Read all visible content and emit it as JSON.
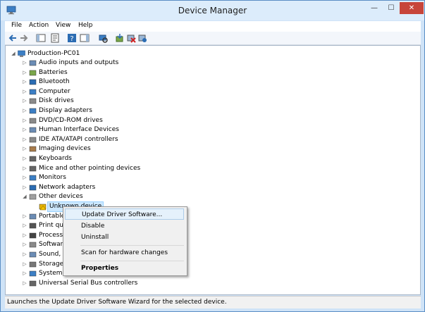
{
  "window": {
    "title": "Device Manager",
    "min_glyph": "—",
    "max_glyph": "☐",
    "close_glyph": "✕"
  },
  "menu": [
    "File",
    "Action",
    "View",
    "Help"
  ],
  "toolbar_icons": [
    "back-icon",
    "forward-icon",
    "show-hide-tree-icon",
    "properties-icon",
    "help-icon",
    "action-pane-icon",
    "scan-hardware-icon",
    "update-driver-icon",
    "disable-device-icon",
    "uninstall-device-icon"
  ],
  "tree": {
    "root": "Production-PC01",
    "items": [
      {
        "label": "Audio inputs and outputs",
        "icon": "speaker-icon",
        "expanded": false
      },
      {
        "label": "Batteries",
        "icon": "battery-icon",
        "expanded": false
      },
      {
        "label": "Bluetooth",
        "icon": "bluetooth-icon",
        "expanded": false
      },
      {
        "label": "Computer",
        "icon": "computer-icon",
        "expanded": false
      },
      {
        "label": "Disk drives",
        "icon": "disk-drive-icon",
        "expanded": false
      },
      {
        "label": "Display adapters",
        "icon": "display-adapter-icon",
        "expanded": false
      },
      {
        "label": "DVD/CD-ROM drives",
        "icon": "dvd-drive-icon",
        "expanded": false
      },
      {
        "label": "Human Interface Devices",
        "icon": "hid-icon",
        "expanded": false
      },
      {
        "label": "IDE ATA/ATAPI controllers",
        "icon": "ide-controller-icon",
        "expanded": false
      },
      {
        "label": "Imaging devices",
        "icon": "camera-icon",
        "expanded": false
      },
      {
        "label": "Keyboards",
        "icon": "keyboard-icon",
        "expanded": false
      },
      {
        "label": "Mice and other pointing devices",
        "icon": "mouse-icon",
        "expanded": false
      },
      {
        "label": "Monitors",
        "icon": "monitor-icon",
        "expanded": false
      },
      {
        "label": "Network adapters",
        "icon": "network-adapter-icon",
        "expanded": false
      },
      {
        "label": "Other devices",
        "icon": "other-devices-icon",
        "expanded": true
      },
      {
        "label": "Unknown device",
        "icon": "warning-device-icon",
        "child": true
      },
      {
        "label": "Portable",
        "icon": "portable-device-icon",
        "expanded": false
      },
      {
        "label": "Print qu",
        "icon": "printer-icon",
        "expanded": false
      },
      {
        "label": "Processo",
        "icon": "processor-icon",
        "expanded": false
      },
      {
        "label": "Software",
        "icon": "software-device-icon",
        "expanded": false
      },
      {
        "label": "Sound, v",
        "icon": "sound-icon",
        "expanded": false
      },
      {
        "label": "Storage",
        "icon": "storage-icon",
        "expanded": false
      },
      {
        "label": "System",
        "icon": "system-device-icon",
        "expanded": false
      },
      {
        "label": "Universal Serial Bus controllers",
        "icon": "usb-icon",
        "expanded": false
      }
    ]
  },
  "context_menu": {
    "items": [
      {
        "label": "Update Driver Software...",
        "highlighted": true
      },
      {
        "label": "Disable"
      },
      {
        "label": "Uninstall"
      },
      {
        "separator": true
      },
      {
        "label": "Scan for hardware changes"
      },
      {
        "separator": true
      },
      {
        "label": "Properties",
        "bold": true
      }
    ]
  },
  "status": "Launches the Update Driver Software Wizard for the selected device.",
  "glyphs": {
    "collapsed": "▷",
    "expanded": "◢"
  }
}
